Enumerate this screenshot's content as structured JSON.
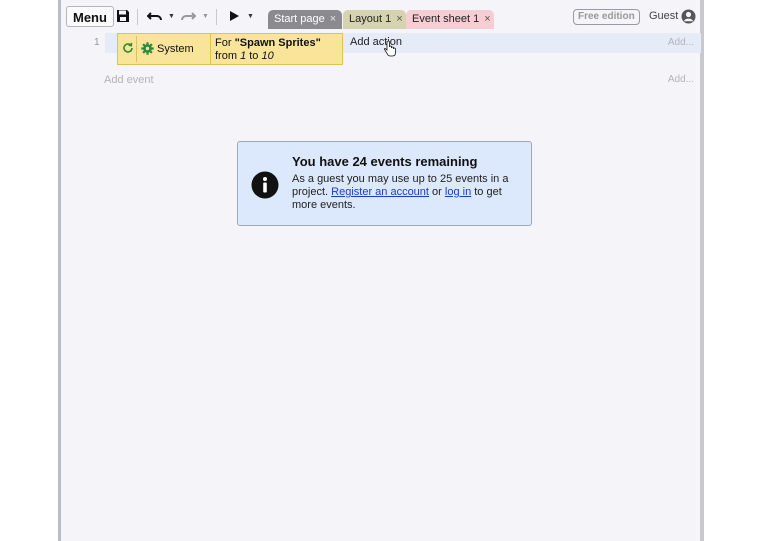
{
  "toolbar": {
    "menu_label": "Menu",
    "tabs": [
      {
        "label": "Start page"
      },
      {
        "label": "Layout 1"
      },
      {
        "label": "Event sheet 1"
      }
    ],
    "close_glyph": "×",
    "edition_badge": "Free edition",
    "user_label": "Guest"
  },
  "event_sheet": {
    "event_number": "1",
    "condition": {
      "object_label": "System",
      "text_prefix": "For ",
      "loop_name": "\"Spawn Sprites\"",
      "text_from": "from ",
      "start": "1",
      "text_to": " to ",
      "end": "10"
    },
    "add_action_label": "Add action",
    "add_right_label": "Add...",
    "add_event_label": "Add event",
    "add_right_label_2": "Add..."
  },
  "notice": {
    "title": "You have 24 events remaining",
    "body_prefix": "As a guest you may use up to 25 events in a project. ",
    "register_link": "Register an account",
    "or_text": " or ",
    "login_link": "log in",
    "body_suffix": " to get more events."
  },
  "colors": {
    "tab_start": "#8a8a8f",
    "tab_layout": "#d6d3b0",
    "tab_events": "#f7cdd4",
    "condition_block": "#f9e59a",
    "notice_bg": "#dce8fb",
    "link": "#1a3bd6"
  },
  "icons": [
    "save-icon",
    "undo-icon",
    "redo-icon",
    "play-icon",
    "user-avatar-icon",
    "loop-icon",
    "gear-icon",
    "info-icon",
    "close-icon"
  ]
}
